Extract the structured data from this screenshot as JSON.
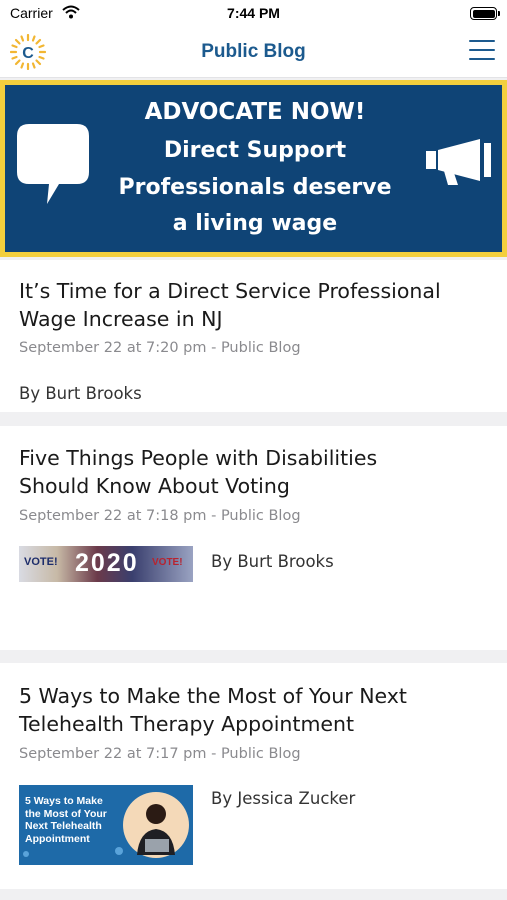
{
  "status_bar": {
    "carrier": "Carrier",
    "time": "7:44 PM"
  },
  "nav": {
    "title": "Public Blog",
    "logo_letter": "C"
  },
  "banner": {
    "line1": "ADVOCATE NOW!",
    "line2": "Direct Support",
    "line3": "Professionals deserve",
    "line4": "a living wage"
  },
  "posts": [
    {
      "title_line1": "It’s Time for a Direct Service Professional",
      "title_line2": "Wage Increase in NJ",
      "meta": "September 22 at 7:20 pm - Public Blog",
      "author": "By Burt Brooks"
    },
    {
      "title_line1": "Five Things People with Disabilities",
      "title_line2": "Should Know About Voting",
      "meta": "September 22 at 7:18 pm - Public Blog",
      "author": "By Burt Brooks",
      "thumb": {
        "left_text": "VOTE!",
        "center_text": "2020",
        "right_text": "VOTE!"
      }
    },
    {
      "title_line1": "5 Ways to Make the Most of Your Next",
      "title_line2": "Telehealth Therapy Appointment",
      "meta": "September 22 at 7:17 pm - Public Blog",
      "author": "By Jessica Zucker",
      "thumb": {
        "lines": [
          "5 Ways to Make",
          "the Most of Your",
          "Next Telehealth",
          "Appointment"
        ]
      }
    }
  ],
  "colors": {
    "brand_blue": "#1c5a8e",
    "banner_bg": "#0f4476",
    "banner_border": "#f3cf3d"
  }
}
